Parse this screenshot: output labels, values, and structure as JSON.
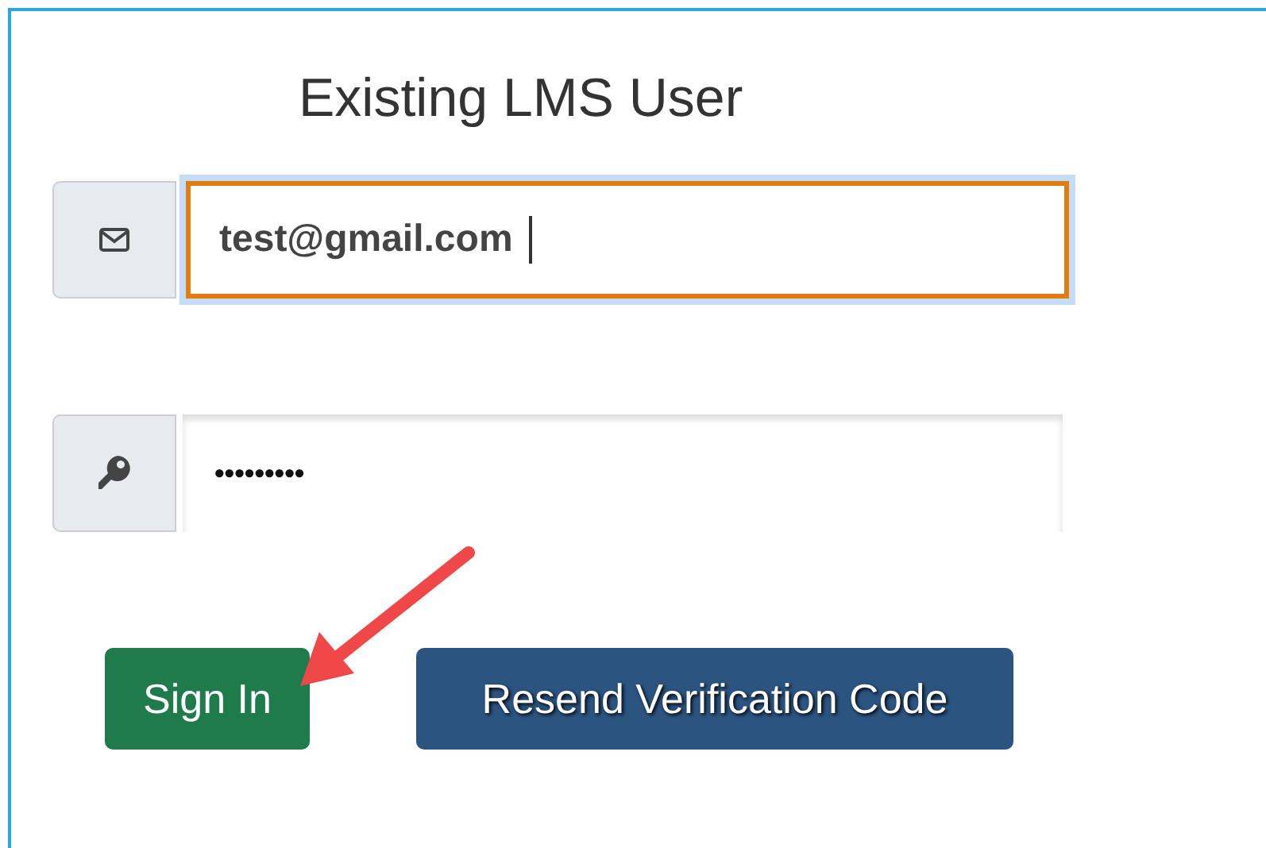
{
  "title": "Existing LMS User",
  "fields": [
    {
      "kind": "email",
      "value": "test@gmail.com",
      "focused": true
    },
    {
      "kind": "password",
      "value": "•••••••••",
      "focused": false
    }
  ],
  "buttons": [
    {
      "label": "Sign In",
      "kind": "success"
    },
    {
      "label": "Resend Verification Code",
      "kind": "primary"
    }
  ]
}
